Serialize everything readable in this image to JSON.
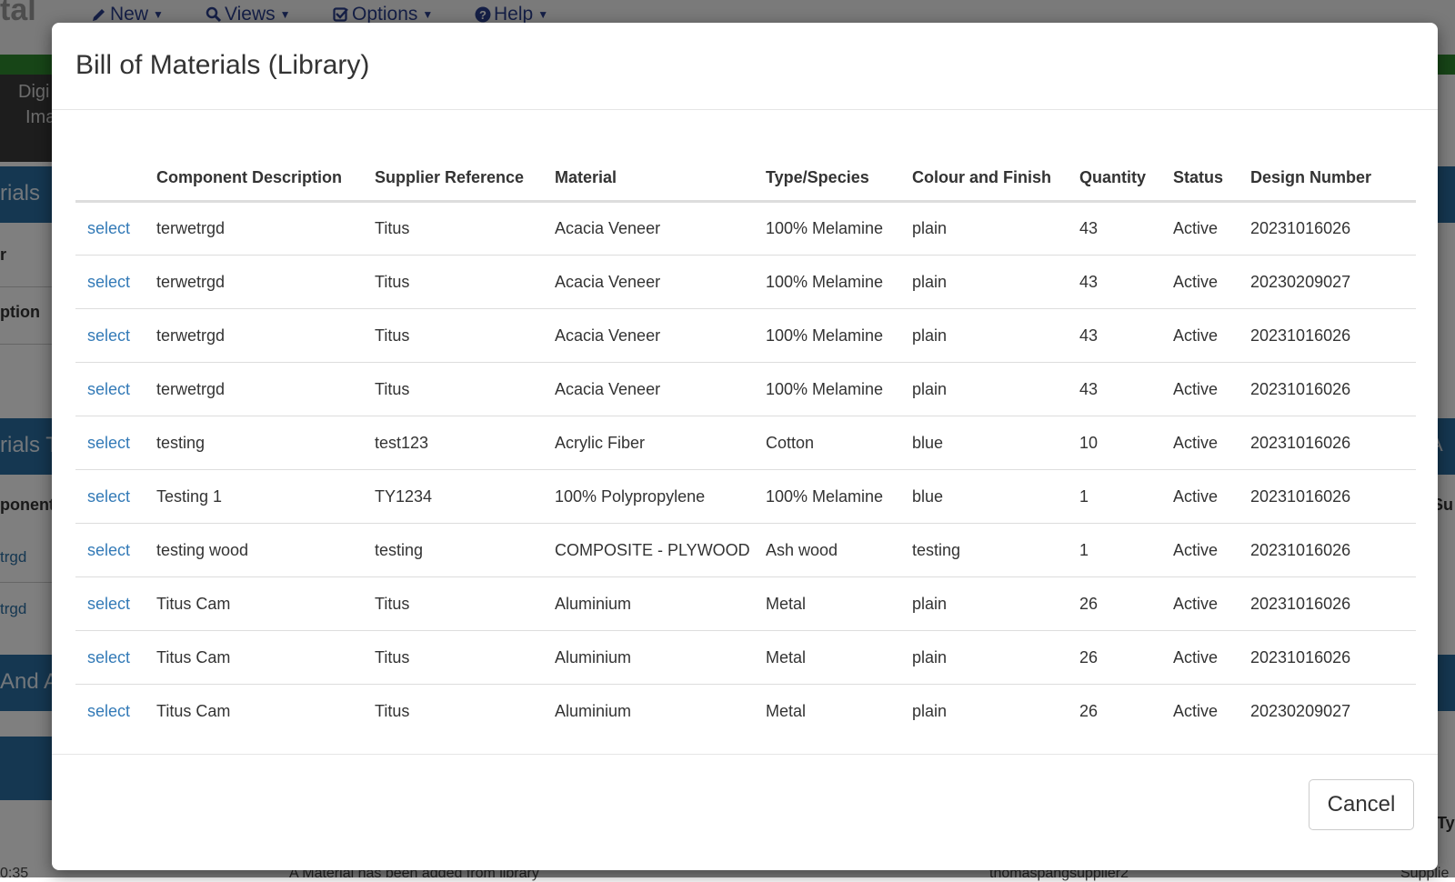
{
  "background": {
    "brand": "tal",
    "menu": [
      {
        "label": "New",
        "icon": "pencil-icon"
      },
      {
        "label": "Views",
        "icon": "search-icon"
      },
      {
        "label": "Options",
        "icon": "checkbox-icon"
      },
      {
        "label": "Help",
        "icon": "question-circle-icon"
      }
    ],
    "darkbox_lines": [
      "Digi",
      "Ima"
    ],
    "section_headers": [
      "rials",
      "rials T",
      "And A"
    ],
    "labels": [
      "r",
      "ption",
      "ponent"
    ],
    "links": [
      "trgd",
      "trgd"
    ],
    "right_labels": [
      "A",
      "Su",
      "Ty"
    ],
    "footer": [
      "0:35",
      "A Material has been added from library",
      "thomaspangsupplier2",
      "Supplie"
    ]
  },
  "modal": {
    "title": "Bill of Materials (Library)",
    "columns": [
      "",
      "Component Description",
      "Supplier Reference",
      "Material",
      "Type/Species",
      "Colour and Finish",
      "Quantity",
      "Status",
      "Design Number"
    ],
    "rows": [
      {
        "action": "select",
        "component": "terwetrgd",
        "supplier": "Titus",
        "material": "Acacia Veneer",
        "type": "100% Melamine",
        "colour": "plain",
        "quantity": "43",
        "status": "Active",
        "design": "20231016026"
      },
      {
        "action": "select",
        "component": "terwetrgd",
        "supplier": "Titus",
        "material": "Acacia Veneer",
        "type": "100% Melamine",
        "colour": "plain",
        "quantity": "43",
        "status": "Active",
        "design": "20230209027"
      },
      {
        "action": "select",
        "component": "terwetrgd",
        "supplier": "Titus",
        "material": "Acacia Veneer",
        "type": "100% Melamine",
        "colour": "plain",
        "quantity": "43",
        "status": "Active",
        "design": "20231016026"
      },
      {
        "action": "select",
        "component": "terwetrgd",
        "supplier": "Titus",
        "material": "Acacia Veneer",
        "type": "100% Melamine",
        "colour": "plain",
        "quantity": "43",
        "status": "Active",
        "design": "20231016026"
      },
      {
        "action": "select",
        "component": "testing",
        "supplier": "test123",
        "material": "Acrylic Fiber",
        "type": "Cotton",
        "colour": "blue",
        "quantity": "10",
        "status": "Active",
        "design": "20231016026"
      },
      {
        "action": "select",
        "component": "Testing 1",
        "supplier": "TY1234",
        "material": "100% Polypropylene",
        "type": "100% Melamine",
        "colour": "blue",
        "quantity": "1",
        "status": "Active",
        "design": "20231016026"
      },
      {
        "action": "select",
        "component": "testing wood",
        "supplier": "testing",
        "material": "COMPOSITE - PLYWOOD",
        "type": "Ash wood",
        "colour": "testing",
        "quantity": "1",
        "status": "Active",
        "design": "20231016026"
      },
      {
        "action": "select",
        "component": "Titus Cam",
        "supplier": "Titus",
        "material": "Aluminium",
        "type": "Metal",
        "colour": "plain",
        "quantity": "26",
        "status": "Active",
        "design": "20231016026"
      },
      {
        "action": "select",
        "component": "Titus Cam",
        "supplier": "Titus",
        "material": "Aluminium",
        "type": "Metal",
        "colour": "plain",
        "quantity": "26",
        "status": "Active",
        "design": "20231016026"
      },
      {
        "action": "select",
        "component": "Titus Cam",
        "supplier": "Titus",
        "material": "Aluminium",
        "type": "Metal",
        "colour": "plain",
        "quantity": "26",
        "status": "Active",
        "design": "20230209027"
      }
    ],
    "cancel_label": "Cancel"
  },
  "colors": {
    "link": "#337ab7",
    "brand_green": "#2e8b2e",
    "section_blue": "#2a6ea3",
    "nav_text": "#2b3f8c"
  }
}
